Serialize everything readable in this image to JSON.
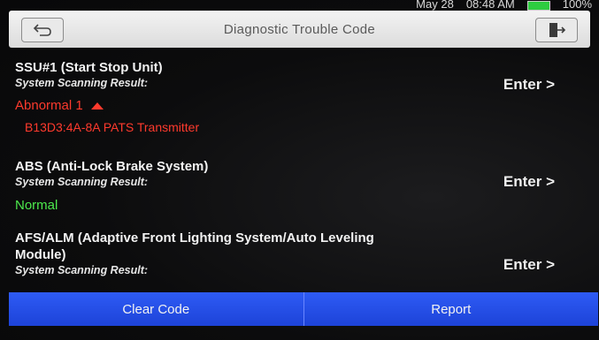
{
  "status_bar": {
    "date": "May 28",
    "time": "08:48 AM",
    "battery": "100%"
  },
  "header": {
    "title": "Diagnostic Trouble Code"
  },
  "modules": [
    {
      "name": "SSU#1 (Start Stop Unit)",
      "scan_label": "System Scanning Result:",
      "result": "Abnormal 1",
      "dtc": "B13D3:4A-8A PATS Transmitter",
      "enter_label": "Enter >"
    },
    {
      "name": "ABS (Anti-Lock Brake System)",
      "scan_label": "System Scanning Result:",
      "result": "Normal",
      "enter_label": "Enter >"
    },
    {
      "name": "AFS/ALM (Adaptive Front Lighting System/Auto Leveling Module)",
      "scan_label": "System Scanning Result:",
      "enter_label": "Enter >"
    }
  ],
  "actions": {
    "clear_code": "Clear Code",
    "report": "Report"
  },
  "colors": {
    "abnormal": "#ff3a2d",
    "normal": "#4dea4d",
    "action_bar": "#2350e8"
  },
  "icons": {
    "back": "back-arrow-icon",
    "exit": "exit-icon",
    "expand": "triangle-up-icon"
  }
}
